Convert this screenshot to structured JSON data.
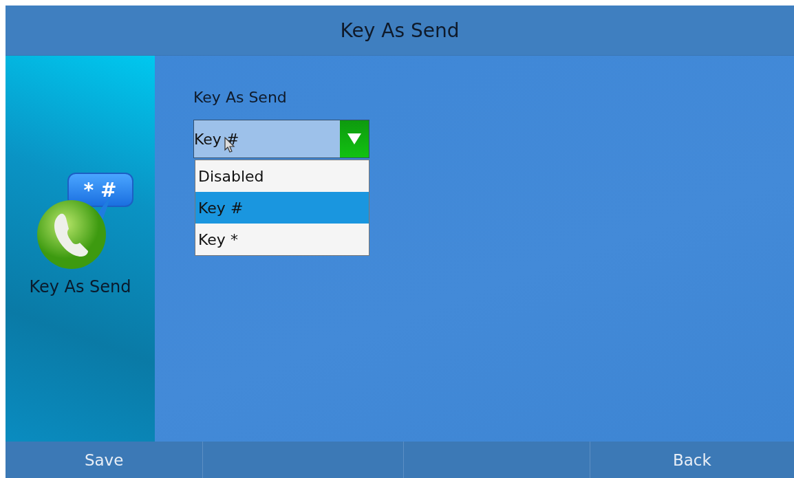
{
  "header": {
    "title": "Key As Send"
  },
  "sidebar": {
    "badge": "* #",
    "label": "Key As Send"
  },
  "field": {
    "label": "Key As Send",
    "value": "Key #",
    "expanded": true,
    "options": [
      {
        "label": "Disabled",
        "selected": false
      },
      {
        "label": "Key #",
        "selected": true
      },
      {
        "label": "Key *",
        "selected": false
      }
    ]
  },
  "softkeys": [
    {
      "kind": "label",
      "label": "Save"
    },
    {
      "kind": "blank"
    },
    {
      "kind": "blank"
    },
    {
      "kind": "label",
      "label": "Back"
    }
  ]
}
